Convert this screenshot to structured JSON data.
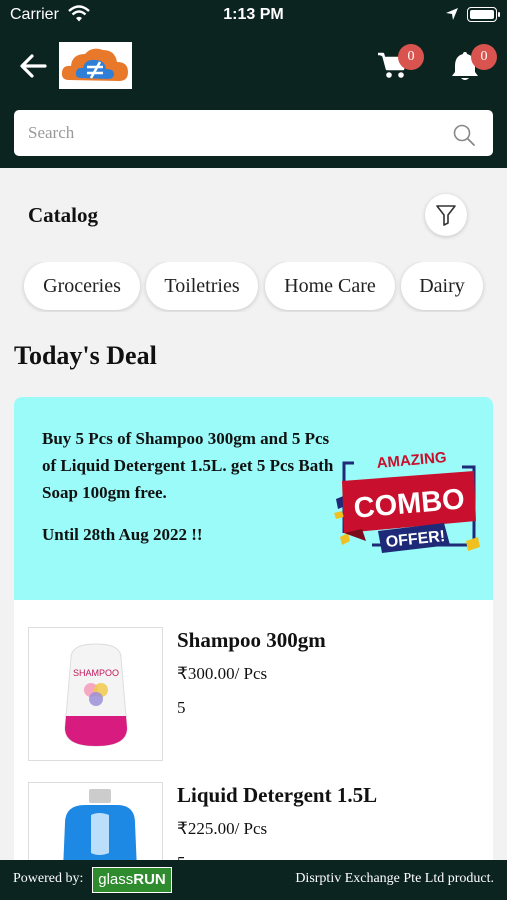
{
  "status_bar": {
    "carrier": "Carrier",
    "time": "1:13 PM"
  },
  "header": {
    "cart_count": "0",
    "notification_count": "0",
    "search_placeholder": "Search"
  },
  "catalog": {
    "title": "Catalog",
    "categories": [
      "Groceries",
      "Toiletries",
      "Home Care",
      "Dairy"
    ]
  },
  "deals": {
    "title": "Today's Deal",
    "banner": {
      "text": "Buy 5 Pcs of Shampoo 300gm and 5 Pcs of Liquid Detergent 1.5L. get 5 Pcs Bath Soap 100gm free.",
      "until": "Until 28th Aug 2022 !!",
      "badge_top": "AMAZING",
      "badge_main": "COMBO",
      "badge_bottom": "OFFER!"
    },
    "products": [
      {
        "name": "Shampoo 300gm",
        "price": "₹300.00/ Pcs",
        "qty": "5",
        "label": "SHAMPOO"
      },
      {
        "name": "Liquid Detergent 1.5L",
        "price": "₹225.00/ Pcs",
        "qty": "5"
      }
    ]
  },
  "footer": {
    "powered_by": "Powered by:",
    "brand_a": "glass",
    "brand_b": "RUN",
    "company": "Disrptiv Exchange Pte Ltd product."
  }
}
